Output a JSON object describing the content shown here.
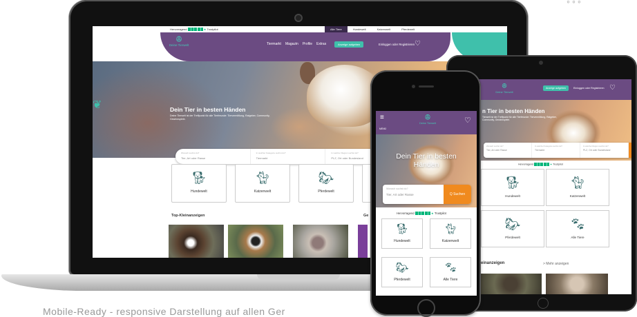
{
  "laptop": {
    "topbar": {
      "rating_label": "Hervorragend",
      "trustpilot": "Trustpilot",
      "tabs": [
        "Alle Tiere",
        "Hundewelt",
        "Katzenwelt",
        "Pferdewelt"
      ]
    },
    "nav": {
      "logo_text": "Deine Tierwelt",
      "menu": [
        "Tiermarkt",
        "Magazin",
        "Profile",
        "Extras"
      ],
      "cta": "Anzeige aufgeben",
      "login": "Einloggen oder Registrieren"
    },
    "hero": {
      "title": "Dein Tier in besten Händen",
      "subtitle": "Deine Tierwelt ist der Treffpunkt für alle Tierfreunde: Tiervermittlung, Ratgeber, Community, Gewinnspiele."
    },
    "search": {
      "field1_label": "Wonach suchst du?",
      "field1_placeholder": "Tier, Art oder Rasse",
      "field2_label": "In welcher Kategorie suchst du?",
      "field2_value": "Tiermarkt",
      "field3_label": "In welcher Region suchst du?",
      "field3_placeholder": "PLZ, Ort oder Bundesland"
    },
    "categories": [
      "Hundewelt",
      "Katzenwelt",
      "Pferdewelt"
    ],
    "top_title": "Top-Kleinanzeigen",
    "side_title": "Ge"
  },
  "tablet": {
    "nav": {
      "logo_text": "Deine Tierwelt",
      "cta": "Anzeige aufgeben",
      "login": "Einloggen oder Registrieren"
    },
    "hero": {
      "title": "n Tier in besten Händen",
      "subtitle": "Tierwelt ist der Treffpunkt für alle Tierfreunde: Tiervermittlung, Ratgeber, Community, Gewinnspiele."
    },
    "search": {
      "field1_label": "Wonach suchst du?",
      "field1_placeholder": "Tier, Art oder Rasse",
      "field2_label": "In welcher Kategorie suchst du?",
      "field2_value": "Tiermarkt",
      "field3_label": "In welcher Region suchst du?",
      "field3_placeholder": "PLZ, Ort oder Bundesland"
    },
    "rating_label": "Hervorragend",
    "trustpilot": "Trustpilot",
    "categories": [
      "Hundewelt",
      "Katzenwelt",
      "Pferdewelt",
      "Alle Tiere"
    ],
    "klein_title": "Kleinanzeigen",
    "more_link": "> Mehr anzeigen"
  },
  "phone": {
    "nav": {
      "menu_label": "MENÜ",
      "logo_text": "Deine Tierwelt"
    },
    "hero": {
      "title": "Dein Tier in besten Händen"
    },
    "search": {
      "label": "Wonach suchst du?",
      "placeholder": "Tier, Art oder Rasse",
      "button": "Q Suchen"
    },
    "rating_label": "Hervorragend",
    "trustpilot": "Trustpilot",
    "categories": [
      "Hundewelt",
      "Katzenwelt",
      "Pferdewelt",
      "Alle Tiere"
    ]
  },
  "caption": "Mobile-Ready - responsive Darstellung auf allen Ger",
  "colors": {
    "brand_purple": "#6b4b82",
    "brand_teal": "#3fc0ab",
    "search_orange": "#f08a1e",
    "trustpilot_green": "#00b67a"
  },
  "icons": [
    "paw-logo-icon",
    "heart-icon",
    "hamburger-menu-icon",
    "dog-icon",
    "cat-icon",
    "horse-icon",
    "all-animals-icon",
    "search-icon",
    "star-icon"
  ]
}
